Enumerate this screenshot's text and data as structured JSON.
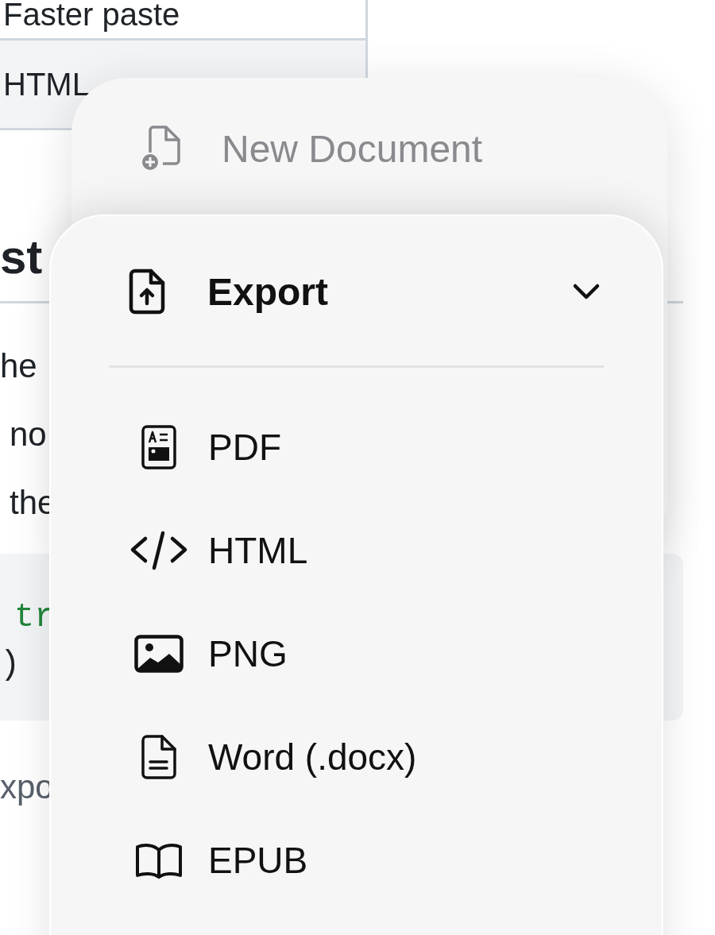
{
  "page": {
    "table_rows": [
      {
        "text": "Faster paste",
        "shaded": false
      },
      {
        "text": "HTML",
        "shaded": true
      }
    ],
    "heading": "st",
    "paragraph_lines": [
      "he",
      "no",
      "the"
    ],
    "code_lines": [
      {
        "text": "tr",
        "kind": "string"
      },
      {
        "text": ")",
        "kind": "plain"
      }
    ],
    "footer_text": "xpo"
  },
  "back_menu": {
    "items": [
      {
        "label": "New Document",
        "kind": "new-document",
        "disabled": true
      }
    ]
  },
  "export_menu": {
    "title": "Export",
    "expanded": true,
    "items": [
      {
        "label": "PDF",
        "kind": "pdf"
      },
      {
        "label": "HTML",
        "kind": "html"
      },
      {
        "label": "PNG",
        "kind": "png"
      },
      {
        "label": "Word (.docx)",
        "kind": "word"
      },
      {
        "label": "EPUB",
        "kind": "epub"
      }
    ]
  }
}
